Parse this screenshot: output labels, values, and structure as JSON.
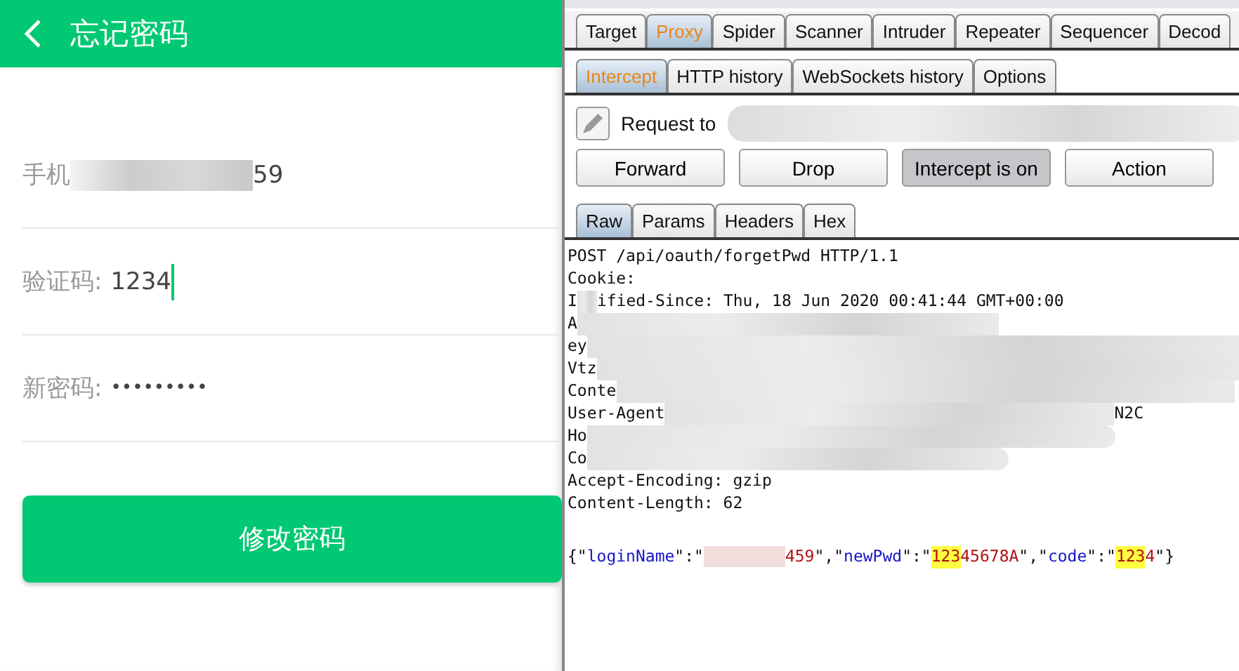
{
  "app": {
    "title": "忘记密码",
    "fields": [
      {
        "kind": "phone",
        "label": "手机",
        "value": "59",
        "focused": false
      },
      {
        "kind": "code",
        "label": "验证码:",
        "value": "1234",
        "focused": true
      },
      {
        "kind": "password",
        "label": "新密码:",
        "value": "•••••••••",
        "focused": false
      }
    ],
    "submit": "修改密码"
  },
  "burp": {
    "tabs": [
      {
        "label": "Target",
        "selected": false
      },
      {
        "label": "Proxy",
        "selected": true
      },
      {
        "label": "Spider",
        "selected": false
      },
      {
        "label": "Scanner",
        "selected": false
      },
      {
        "label": "Intruder",
        "selected": false
      },
      {
        "label": "Repeater",
        "selected": false
      },
      {
        "label": "Sequencer",
        "selected": false
      },
      {
        "label": "Decod",
        "selected": false
      }
    ],
    "subtabs": [
      {
        "label": "Intercept",
        "selected": true
      },
      {
        "label": "HTTP history",
        "selected": false
      },
      {
        "label": "WebSockets history",
        "selected": false
      },
      {
        "label": "Options",
        "selected": false
      }
    ],
    "request_label": "Request to",
    "buttons": [
      {
        "label": "Forward",
        "pressed": false
      },
      {
        "label": "Drop",
        "pressed": false
      },
      {
        "label": "Intercept is on",
        "pressed": true
      },
      {
        "label": "Action",
        "pressed": false
      }
    ],
    "view_tabs": [
      {
        "label": "Raw",
        "selected": true
      },
      {
        "label": "Params",
        "selected": false
      },
      {
        "label": "Headers",
        "selected": false
      },
      {
        "label": "Hex",
        "selected": false
      }
    ],
    "lines": [
      {
        "start": "POST /api/oauth/forgetPwd HTTP/1.1"
      },
      {
        "start": "Cookie:"
      },
      {
        "start": "I",
        "redacted": true,
        "end": "ified-Since: Thu, 18 Jun 2020 00:41:44 GMT+00:00"
      },
      {
        "start": "A",
        "redacted": true
      },
      {
        "start": "ey",
        "redacted": true
      },
      {
        "start": "Vtz",
        "redacted": true
      },
      {
        "start": "Conte",
        "redacted": true
      },
      {
        "start": "User-Agent",
        "redacted": true,
        "end": "N2C"
      },
      {
        "start": "Ho",
        "redacted": true
      },
      {
        "start": "Co",
        "redacted": true
      },
      {
        "start": "Accept-Encoding: gzip"
      },
      {
        "start": "Content-Length: 62"
      }
    ],
    "body": [
      {
        "kind": "punct",
        "text": "{\""
      },
      {
        "kind": "key",
        "text": "loginName"
      },
      {
        "kind": "punct",
        "text": "\":\""
      },
      {
        "kind": "redacted"
      },
      {
        "kind": "value",
        "text": "459"
      },
      {
        "kind": "punct",
        "text": "\",\""
      },
      {
        "kind": "key",
        "text": "newPwd"
      },
      {
        "kind": "punct",
        "text": "\":\""
      },
      {
        "kind": "highlight",
        "text": "123"
      },
      {
        "kind": "value",
        "text": "45678A"
      },
      {
        "kind": "punct",
        "text": "\",\""
      },
      {
        "kind": "key",
        "text": "code"
      },
      {
        "kind": "punct",
        "text": "\":\""
      },
      {
        "kind": "highlight",
        "text": "123"
      },
      {
        "kind": "value",
        "text": "4"
      },
      {
        "kind": "punct",
        "text": "\"}"
      }
    ]
  }
}
